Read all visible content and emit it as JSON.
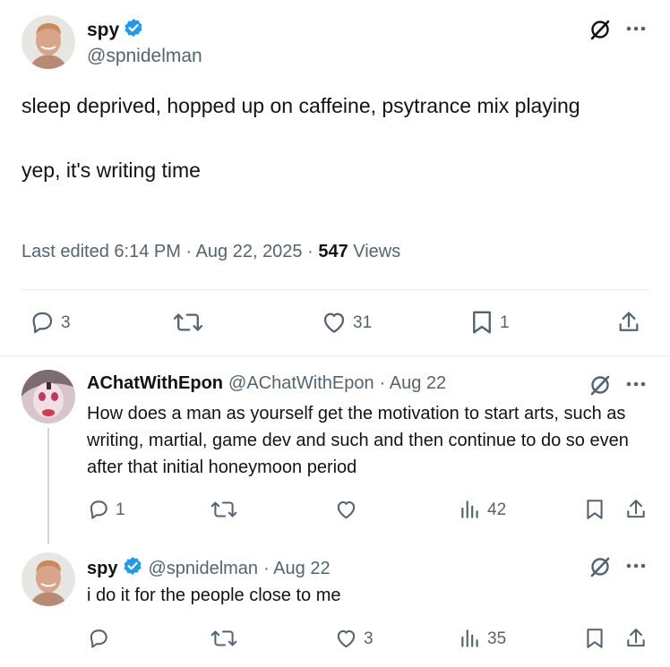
{
  "main_tweet": {
    "author_name": "spy",
    "verified": true,
    "handle": "@spnidelman",
    "text": "sleep deprived, hopped up on caffeine, psytrance mix playing\n\nyep, it's writing time",
    "edited_label": "Last edited 6:14 PM · Aug 22, 2025 · ",
    "views_count": "547",
    "views_label": " Views",
    "actions": {
      "replies": "3",
      "reposts": "",
      "likes": "31",
      "bookmarks": "1"
    }
  },
  "replies": [
    {
      "author_name": "AChatWithEpon",
      "handle": "@AChatWithEpon",
      "date": "· Aug 22",
      "text": "How does a man as yourself get the motivation to start arts, such as writing, martial, game dev and such and then continue to do so even after that initial honeymoon period",
      "actions": {
        "replies": "1",
        "reposts": "",
        "likes": "",
        "views": "42"
      }
    },
    {
      "author_name": "spy",
      "verified": true,
      "handle": "@spnidelman",
      "date": "· Aug 22",
      "text": "i do it for the people close to me",
      "actions": {
        "replies": "",
        "reposts": "",
        "likes": "3",
        "views": "35"
      }
    }
  ],
  "colors": {
    "accent": "#1d9bf0",
    "muted": "#536471",
    "text": "#0f1419",
    "divider": "#e6ecf0"
  }
}
